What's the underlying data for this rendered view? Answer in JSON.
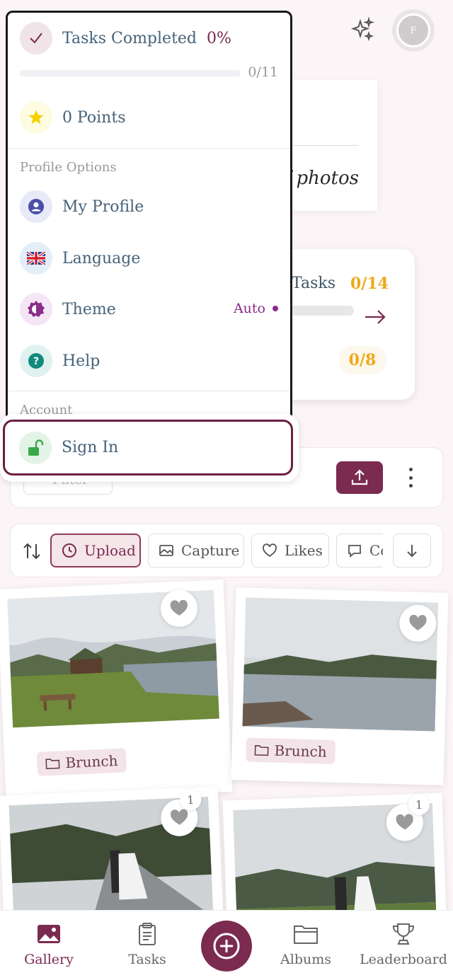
{
  "header": {
    "avatar_initial": "F"
  },
  "welcome_card": {
    "text_fragment": "f photos"
  },
  "tasks_card": {
    "label": "Tasks",
    "count": "0/14",
    "secondary_count": "0/8"
  },
  "toolbar": {
    "filter_label": "Filter"
  },
  "sort": {
    "chips": [
      {
        "label": "Upload",
        "icon": "clock-icon"
      },
      {
        "label": "Capture",
        "icon": "image-icon"
      },
      {
        "label": "Likes",
        "icon": "heart-icon"
      },
      {
        "label": "Co",
        "icon": "comment-icon"
      }
    ]
  },
  "photos": [
    {
      "album": "Brunch",
      "likes": ""
    },
    {
      "album": "Brunch",
      "likes": ""
    },
    {
      "album": "",
      "likes": "1"
    },
    {
      "album": "",
      "likes": "1"
    }
  ],
  "menu": {
    "tasks_label": "Tasks Completed",
    "tasks_percent": "0%",
    "tasks_count": "0/11",
    "tasks_progress": 0,
    "points_label": "0 Points",
    "profile_section": "Profile Options",
    "my_profile": "My Profile",
    "language": "Language",
    "theme": "Theme",
    "theme_value": "Auto",
    "help": "Help",
    "account_section": "Account",
    "sign_in": "Sign In"
  },
  "nav": {
    "gallery": "Gallery",
    "tasks": "Tasks",
    "albums": "Albums",
    "leaderboard": "Leaderboard"
  },
  "colors": {
    "accent": "#7b2a50",
    "points_star": "#f5d000",
    "tasks_count": "#f0a818",
    "theme_value": "#8a2a8a"
  }
}
